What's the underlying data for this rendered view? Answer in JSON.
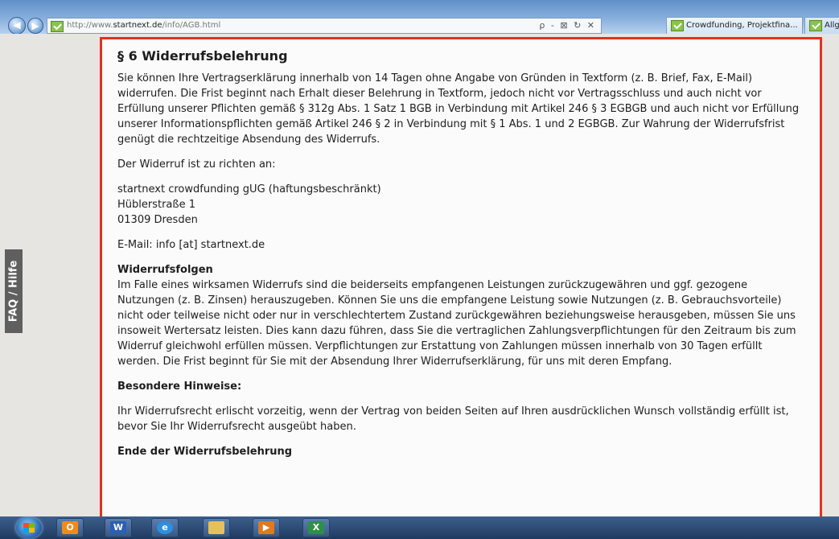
{
  "browser": {
    "url_prefix": "http://www.",
    "url_domain": "startnext.de",
    "url_path": "/info/AGB.html",
    "address_tools": "ρ - ⊠ ↻ ✕",
    "tabs": [
      {
        "label": "Crowdfunding, Projektfina..."
      },
      {
        "label": "Allg"
      }
    ]
  },
  "sidebar": {
    "faq_label": "FAQ / Hilfe"
  },
  "content": {
    "heading": "§ 6 Widerrufsbelehrung",
    "para1": "Sie können Ihre Vertragserklärung innerhalb von 14 Tagen ohne Angabe von Gründen in Textform (z. B. Brief, Fax, E-Mail) widerrufen. Die Frist beginnt nach Erhalt dieser Belehrung in Textform, jedoch nicht vor Vertragsschluss und auch nicht vor Erfüllung unserer Pflichten gemäß § 312g Abs. 1 Satz 1 BGB in Verbindung mit Artikel 246 § 3 EGBGB und auch nicht vor Erfüllung unserer Informationspflichten gemäß Artikel 246 § 2 in Verbindung mit § 1 Abs. 1 und 2 EGBGB. Zur Wahrung der Widerrufsfrist genügt die rechtzeitige Absendung des Widerrufs.",
    "para2": "Der Widerruf ist zu richten an:",
    "address": {
      "line1": "startnext crowdfunding gUG (haftungsbeschränkt)",
      "line2": "Hüblerstraße 1",
      "line3": "01309 Dresden"
    },
    "email": "E-Mail: info [at] startnext.de",
    "consequences_title": "Widerrufsfolgen",
    "consequences_text": "Im Falle eines wirksamen Widerrufs sind die beiderseits empfangenen Leistungen zurückzugewähren und ggf. gezogene Nutzungen (z. B. Zinsen) herauszugeben. Können Sie uns die empfangene Leistung sowie Nutzungen (z. B. Gebrauchsvorteile) nicht oder teilweise nicht oder nur in verschlechtertem Zustand zurückgewähren beziehungsweise herausgeben, müssen Sie uns insoweit Wertersatz leisten. Dies kann dazu führen, dass Sie die vertraglichen Zahlungsverpflichtungen für den Zeitraum bis zum Widerruf gleichwohl erfüllen müssen. Verpflichtungen zur Erstattung von Zahlungen müssen innerhalb von 30 Tagen erfüllt werden. Die Frist beginnt für Sie mit der Absendung Ihrer Widerrufserklärung, für uns mit deren Empfang.",
    "notes_title": "Besondere Hinweise:",
    "notes_text": "Ihr Widerrufsrecht erlischt vorzeitig, wenn der Vertrag von beiden Seiten auf Ihren ausdrücklichen Wunsch vollständig erfüllt ist, bevor Sie Ihr Widerrufsrecht ausgeübt haben.",
    "end": "Ende der Widerrufsbelehrung"
  },
  "taskbar": {
    "items": [
      {
        "icon": "outlook-icon",
        "glyph": "O"
      },
      {
        "icon": "word-icon",
        "glyph": "W"
      },
      {
        "icon": "internet-explorer-icon",
        "glyph": "e"
      },
      {
        "icon": "file-explorer-icon",
        "glyph": ""
      },
      {
        "icon": "media-player-icon",
        "glyph": "▶"
      },
      {
        "icon": "excel-icon",
        "glyph": "X"
      }
    ]
  },
  "colors": {
    "accent_border": "#e3321d",
    "faq_bg": "#5f5f5f"
  }
}
